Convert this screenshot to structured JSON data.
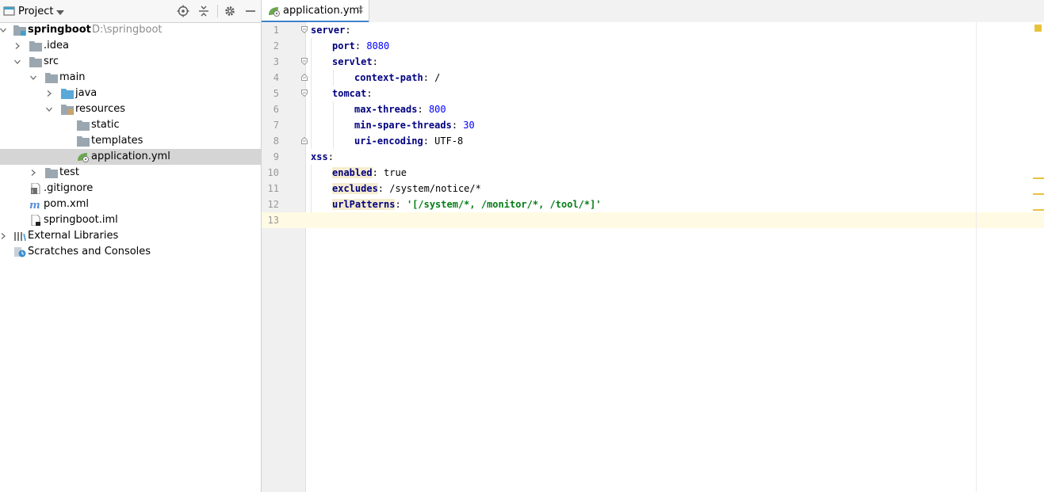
{
  "project_panel": {
    "title": "Project",
    "tree": [
      {
        "label": "springboot",
        "path": "D:\\springboot",
        "depth": 0,
        "expanded": true,
        "icon": "module-folder-icon",
        "bold": true
      },
      {
        "label": ".idea",
        "depth": 1,
        "expanded": false,
        "icon": "folder-icon"
      },
      {
        "label": "src",
        "depth": 1,
        "expanded": true,
        "icon": "folder-icon"
      },
      {
        "label": "main",
        "depth": 2,
        "expanded": true,
        "icon": "folder-icon"
      },
      {
        "label": "java",
        "depth": 3,
        "expanded": false,
        "icon": "source-folder-icon"
      },
      {
        "label": "resources",
        "depth": 3,
        "expanded": true,
        "icon": "resources-folder-icon"
      },
      {
        "label": "static",
        "depth": 4,
        "icon": "folder-icon"
      },
      {
        "label": "templates",
        "depth": 4,
        "icon": "folder-icon"
      },
      {
        "label": "application.yml",
        "depth": 4,
        "icon": "spring-yaml-icon",
        "selected": true
      },
      {
        "label": "test",
        "depth": 2,
        "expanded": false,
        "icon": "folder-icon"
      },
      {
        "label": ".gitignore",
        "depth": 1,
        "icon": "gitignore-icon"
      },
      {
        "label": "pom.xml",
        "depth": 1,
        "icon": "maven-icon"
      },
      {
        "label": "springboot.iml",
        "depth": 1,
        "icon": "iml-file-icon"
      },
      {
        "label": "External Libraries",
        "depth": 0,
        "expanded": false,
        "icon": "libraries-icon"
      },
      {
        "label": "Scratches and Consoles",
        "depth": 0,
        "icon": "scratches-icon"
      }
    ]
  },
  "editor": {
    "tab_label": "application.yml",
    "close_glyph": "×",
    "line_numbers": [
      "1",
      "2",
      "3",
      "4",
      "5",
      "6",
      "7",
      "8",
      "9",
      "10",
      "11",
      "12",
      "13"
    ],
    "lines": [
      {
        "key": "server",
        "sep": ":",
        "value": ""
      },
      {
        "key": "port",
        "sep": ": ",
        "value": "8080",
        "vtype": "num"
      },
      {
        "key": "servlet",
        "sep": ":",
        "value": ""
      },
      {
        "key": "context-path",
        "sep": ": ",
        "value": "/",
        "vtype": "plain"
      },
      {
        "key": "tomcat",
        "sep": ":",
        "value": ""
      },
      {
        "key": "max-threads",
        "sep": ": ",
        "value": "800",
        "vtype": "num"
      },
      {
        "key": "min-spare-threads",
        "sep": ": ",
        "value": "30",
        "vtype": "num"
      },
      {
        "key": "uri-encoding",
        "sep": ": ",
        "value": "UTF-8",
        "vtype": "plain"
      },
      {
        "key": "xss",
        "sep": ":",
        "value": ""
      },
      {
        "key": "enabled",
        "sep": ": ",
        "value": "true",
        "vtype": "plain",
        "highlight": true
      },
      {
        "key": "excludes",
        "sep": ": ",
        "value": "/system/notice/*",
        "vtype": "plain",
        "highlight": true
      },
      {
        "key": "urlPatterns",
        "sep": ": ",
        "value": "'[/system/*, /monitor/*, /tool/*]'",
        "vtype": "str",
        "highlight": true
      },
      {
        "key": "",
        "sep": "",
        "value": ""
      }
    ]
  },
  "colors": {
    "key": "#000080",
    "number": "#0000ff",
    "string": "#067d17",
    "tab_underline": "#4083c9",
    "warning_marker": "#e8c23c",
    "selection": "#d5d5d5"
  }
}
